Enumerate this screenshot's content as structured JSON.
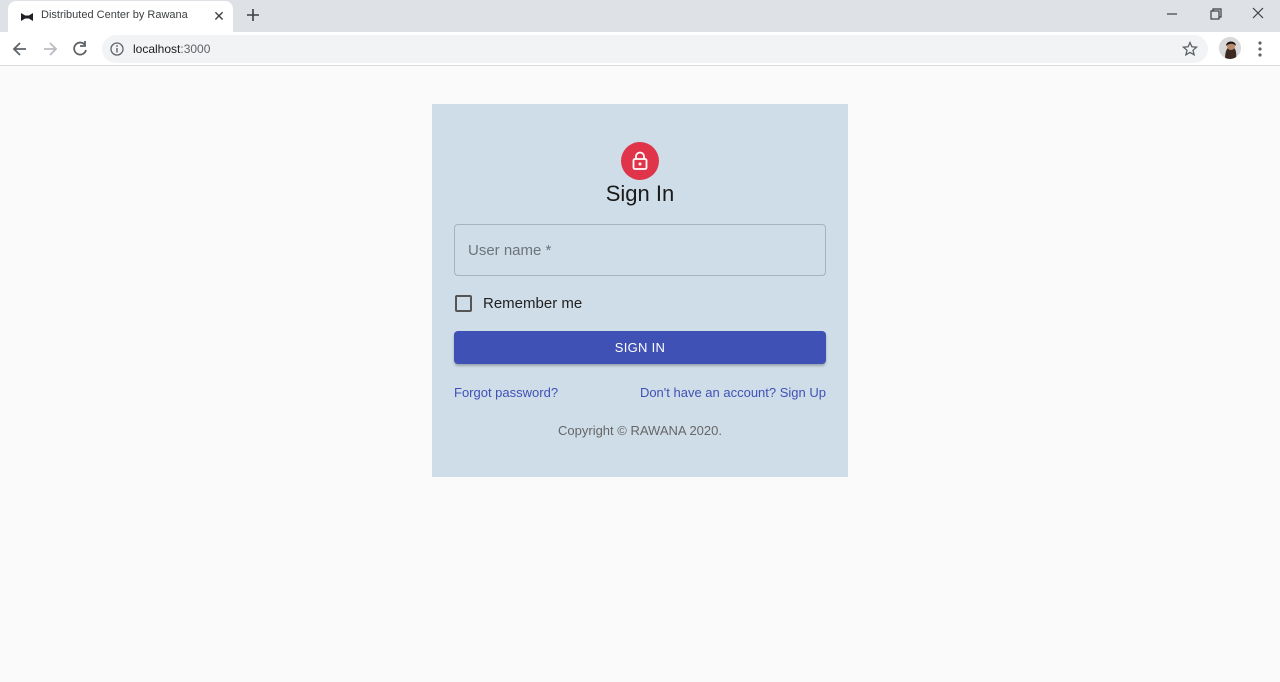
{
  "browser": {
    "tab_title": "Distributed Center by Rawana",
    "tab_close": "✕",
    "url_host": "localhost",
    "url_port": ":3000"
  },
  "signin": {
    "title": "Sign In",
    "username_label": "User name *",
    "remember_label": "Remember me",
    "button_label": "SIGN IN",
    "forgot_link": "Forgot password?",
    "signup_link": "Don't have an account? Sign Up",
    "copyright": "Copyright © RAWANA 2020."
  },
  "colors": {
    "page_background": "#fafafa",
    "card_background": "#cfdde8",
    "primary": "#3f51b5",
    "lock_avatar": "#e0344a"
  }
}
